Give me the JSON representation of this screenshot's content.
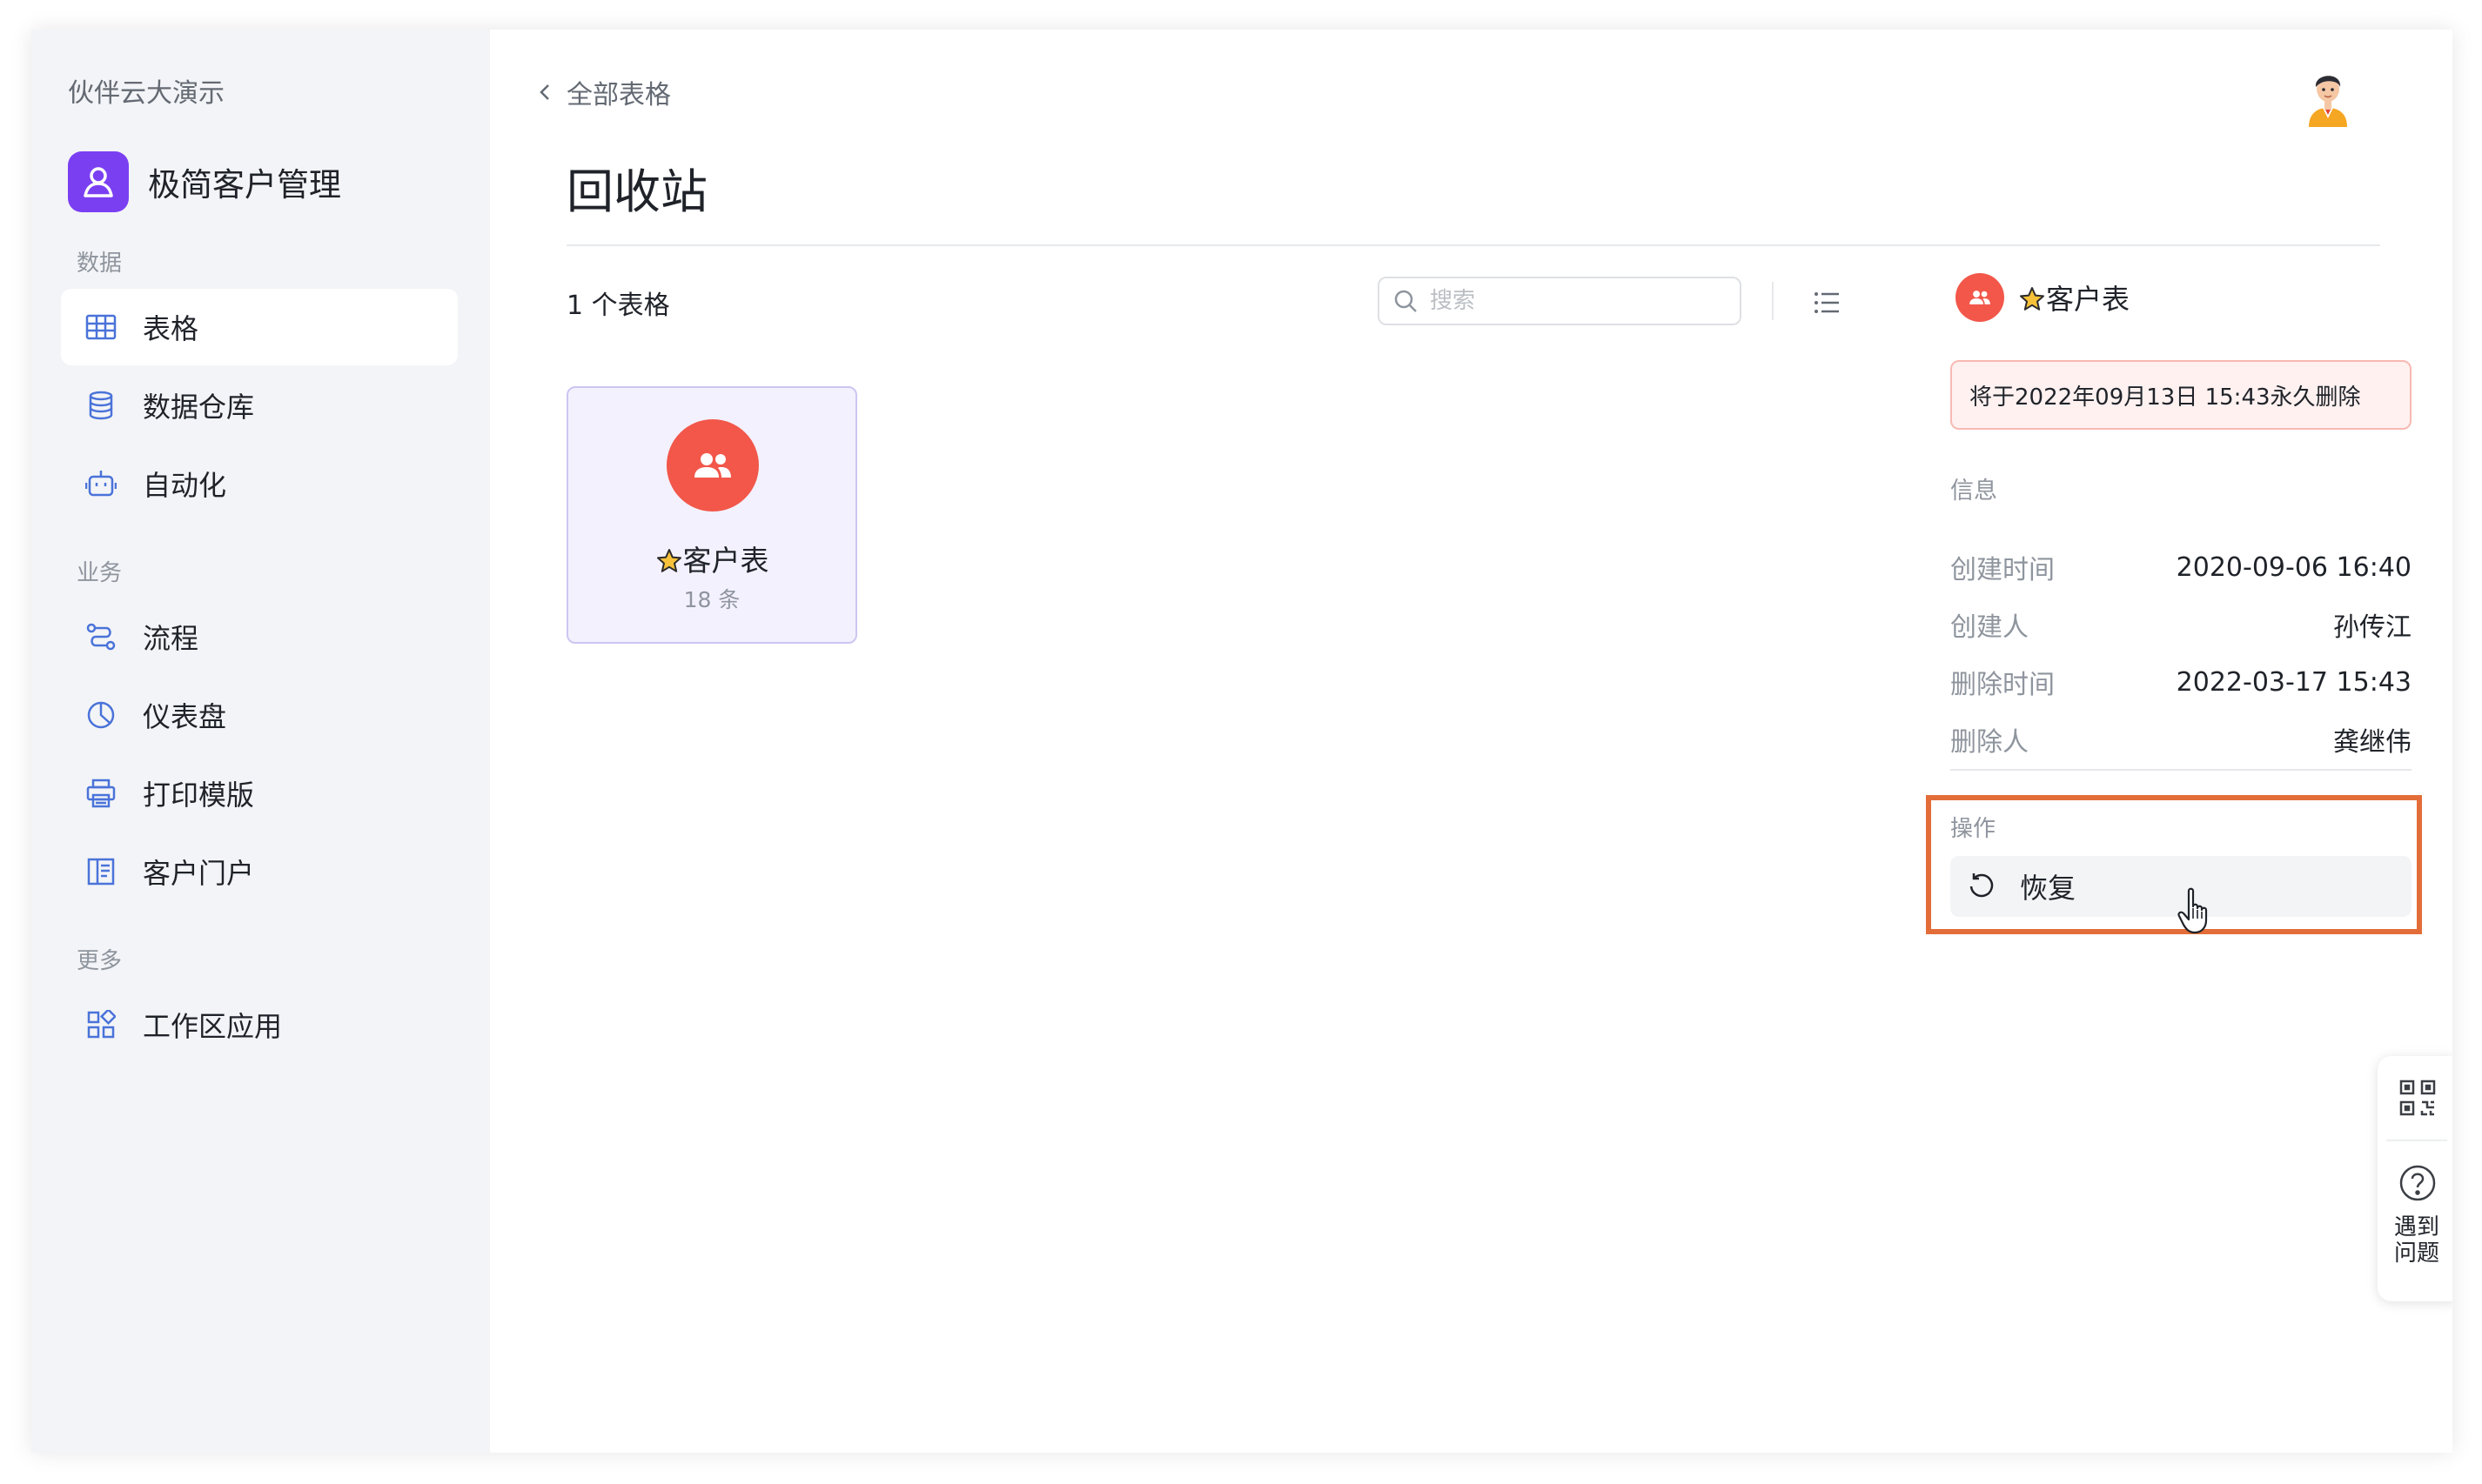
{
  "sidebar": {
    "workspace": "伙伴云大演示",
    "app_name": "极简客户管理",
    "sections": {
      "data": "数据",
      "business": "业务",
      "more": "更多"
    },
    "items": [
      {
        "label": "表格",
        "icon": "table-icon",
        "active": true
      },
      {
        "label": "数据仓库",
        "icon": "database-icon"
      },
      {
        "label": "自动化",
        "icon": "robot-icon"
      },
      {
        "label": "流程",
        "icon": "workflow-icon"
      },
      {
        "label": "仪表盘",
        "icon": "dashboard-icon"
      },
      {
        "label": "打印模版",
        "icon": "printer-icon"
      },
      {
        "label": "客户门户",
        "icon": "portal-icon"
      },
      {
        "label": "工作区应用",
        "icon": "apps-icon"
      }
    ]
  },
  "header": {
    "back_label": "全部表格",
    "title": "回收站"
  },
  "toolbar": {
    "count": "1 个表格",
    "search_placeholder": "搜索"
  },
  "cards": [
    {
      "name": "客户表",
      "count": "18 条",
      "icon": "people-icon",
      "star": "star-icon"
    }
  ],
  "detail": {
    "name": "客户表",
    "warning": "将于2022年09月13日 15:43永久删除",
    "info_label": "信息",
    "rows": [
      {
        "key": "创建时间",
        "value": "2020-09-06 16:40"
      },
      {
        "key": "创建人",
        "value": "孙传江"
      },
      {
        "key": "删除时间",
        "value": "2022-03-17 15:43"
      },
      {
        "key": "删除人",
        "value": "龚继伟"
      }
    ],
    "operations_label": "操作",
    "restore_label": "恢复"
  },
  "float": {
    "help_line1": "遇到",
    "help_line2": "问题"
  },
  "colors": {
    "accent": "#7b3ff2",
    "nav_icon": "#4a73d9",
    "table_icon_bg": "#f2574a",
    "highlight": "#e36d39"
  }
}
